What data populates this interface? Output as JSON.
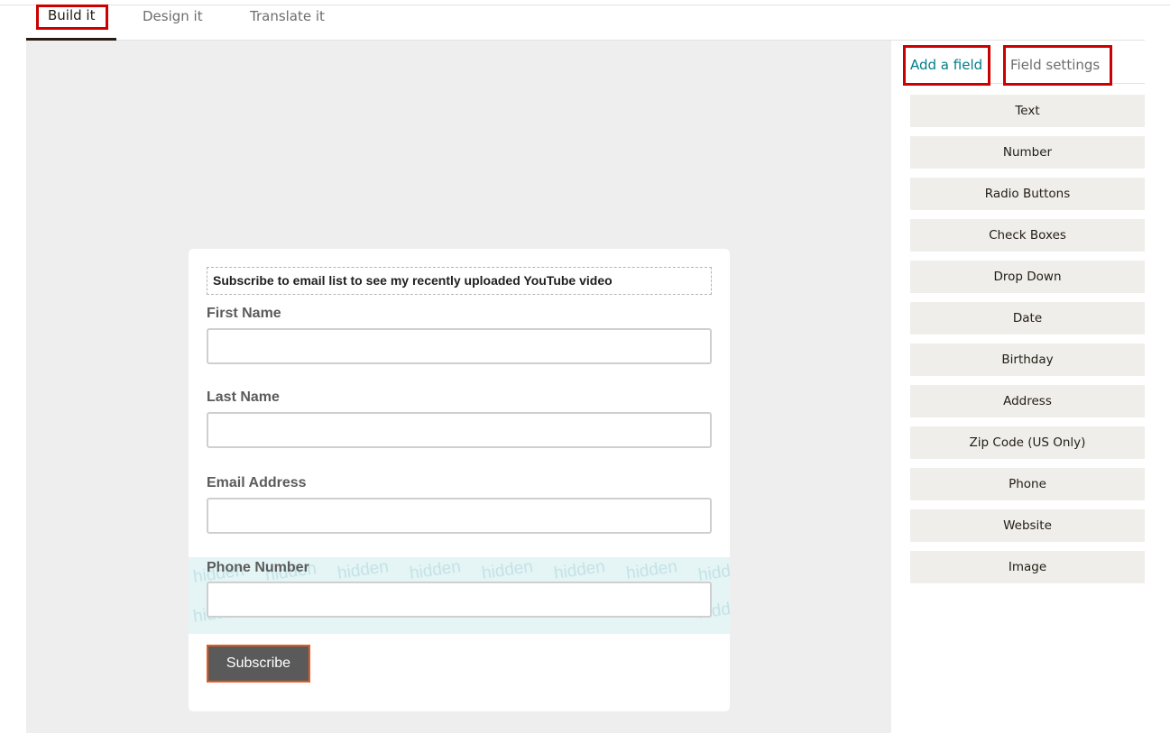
{
  "tabs": {
    "build": "Build it",
    "design": "Design it",
    "translate": "Translate it"
  },
  "form": {
    "header": "Subscribe to email list to see my recently uploaded YouTube video",
    "fields": [
      {
        "label": "First Name"
      },
      {
        "label": "Last Name"
      },
      {
        "label": "Email Address"
      },
      {
        "label": "Phone Number"
      }
    ],
    "hidden_watermark": "hidden",
    "submit_label": "Subscribe"
  },
  "right_panel": {
    "tabs": {
      "add_field": "Add a field",
      "field_settings": "Field settings"
    },
    "field_types": [
      "Text",
      "Number",
      "Radio Buttons",
      "Check Boxes",
      "Drop Down",
      "Date",
      "Birthday",
      "Address",
      "Zip Code (US Only)",
      "Phone",
      "Website",
      "Image"
    ]
  },
  "colors": {
    "accent": "#007c89",
    "highlight_box": "#cc0000",
    "button_border": "#e55a1d",
    "button_bg": "#5a5a5a",
    "hidden_band": "#e5f4f5"
  }
}
